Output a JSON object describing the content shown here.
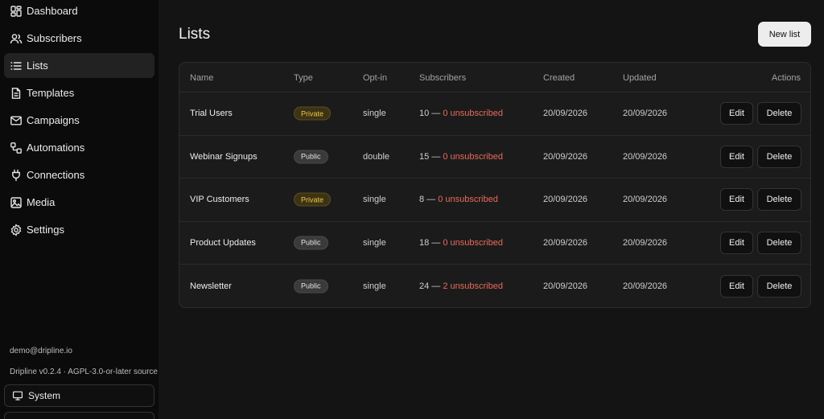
{
  "sidebar": {
    "nav": [
      {
        "label": "Dashboard",
        "icon": "dashboard-icon",
        "active": false
      },
      {
        "label": "Subscribers",
        "icon": "users-icon",
        "active": false
      },
      {
        "label": "Lists",
        "icon": "list-icon",
        "active": true
      },
      {
        "label": "Templates",
        "icon": "file-text-icon",
        "active": false
      },
      {
        "label": "Campaigns",
        "icon": "mail-icon",
        "active": false
      },
      {
        "label": "Automations",
        "icon": "workflow-icon",
        "active": false
      },
      {
        "label": "Connections",
        "icon": "plug-icon",
        "active": false
      },
      {
        "label": "Media",
        "icon": "image-icon",
        "active": false
      },
      {
        "label": "Settings",
        "icon": "gear-icon",
        "active": false
      }
    ],
    "user_email": "demo@dripline.io",
    "version_text": "Dripline v0.2.4 · AGPL-3.0-or-later source",
    "theme_label": "System"
  },
  "main": {
    "title": "Lists",
    "new_list_label": "New list",
    "table": {
      "headers": {
        "name": "Name",
        "type": "Type",
        "optin": "Opt-in",
        "subscribers": "Subscribers",
        "created": "Created",
        "updated": "Updated",
        "actions": "Actions"
      },
      "rows": [
        {
          "name": "Trial Users",
          "type": "Private",
          "optin": "single",
          "subs": "10 —",
          "unsub": "0 unsubscribed",
          "created": "20/09/2026",
          "updated": "20/09/2026",
          "edit": "Edit",
          "delete": "Delete"
        },
        {
          "name": "Webinar Signups",
          "type": "Public",
          "optin": "double",
          "subs": "15 —",
          "unsub": "0 unsubscribed",
          "created": "20/09/2026",
          "updated": "20/09/2026",
          "edit": "Edit",
          "delete": "Delete"
        },
        {
          "name": "VIP Customers",
          "type": "Private",
          "optin": "single",
          "subs": "8 —",
          "unsub": "0 unsubscribed",
          "created": "20/09/2026",
          "updated": "20/09/2026",
          "edit": "Edit",
          "delete": "Delete"
        },
        {
          "name": "Product Updates",
          "type": "Public",
          "optin": "single",
          "subs": "18 —",
          "unsub": "0 unsubscribed",
          "created": "20/09/2026",
          "updated": "20/09/2026",
          "edit": "Edit",
          "delete": "Delete"
        },
        {
          "name": "Newsletter",
          "type": "Public",
          "optin": "single",
          "subs": "24 —",
          "unsub": "2 unsubscribed",
          "created": "20/09/2026",
          "updated": "20/09/2026",
          "edit": "Edit",
          "delete": "Delete"
        }
      ]
    }
  },
  "colors": {
    "background": "#141414",
    "sidebar": "#0b0b0b",
    "private_badge": "#f0c73e",
    "unsubscribed": "#e86a5c"
  }
}
